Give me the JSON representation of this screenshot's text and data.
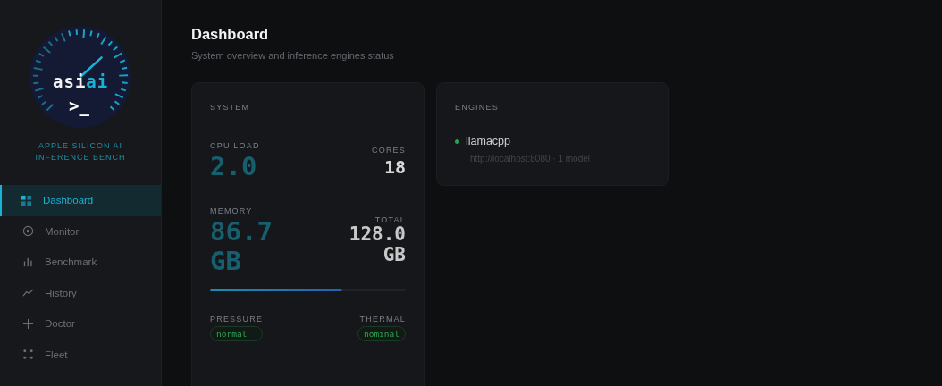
{
  "sidebar": {
    "logo": {
      "wordmark_start": "asi",
      "wordmark_end": "ai",
      "prompt": ">_"
    },
    "tagline": "APPLE SILICON AI INFERENCE BENCH",
    "nav": [
      {
        "label": "Dashboard",
        "kind": "grid",
        "selected": true
      },
      {
        "label": "Monitor",
        "kind": "target",
        "selected": false
      },
      {
        "label": "Benchmark",
        "kind": "bars",
        "selected": false
      },
      {
        "label": "History",
        "kind": "trend",
        "selected": false
      },
      {
        "label": "Doctor",
        "kind": "plus",
        "selected": false
      },
      {
        "label": "Fleet",
        "kind": "dots",
        "selected": false
      }
    ]
  },
  "header": {
    "title": "Dashboard",
    "subtitle": "System overview and inference engines status"
  },
  "system": {
    "heading": "SYSTEM",
    "cpu_label": "CPU LOAD",
    "cpu_value": "2.0",
    "cores_label": "CORES",
    "cores_value": "18",
    "memory_label": "MEMORY",
    "memory_value": "86.7",
    "memory_unit": "GB",
    "total_label": "TOTAL",
    "total_value": "128.0",
    "total_unit": "GB",
    "memory_bar": {
      "level": 0.677
    },
    "pressure_label": "PRESSURE",
    "pressure_value": "normal",
    "thermal_label": "THERMAL",
    "thermal_value": "nominal"
  },
  "engines": {
    "heading": "ENGINES",
    "items": [
      {
        "name": "llamacpp",
        "color": "#22a552",
        "detail": "http://localhost:8080 · 1 model"
      }
    ]
  }
}
